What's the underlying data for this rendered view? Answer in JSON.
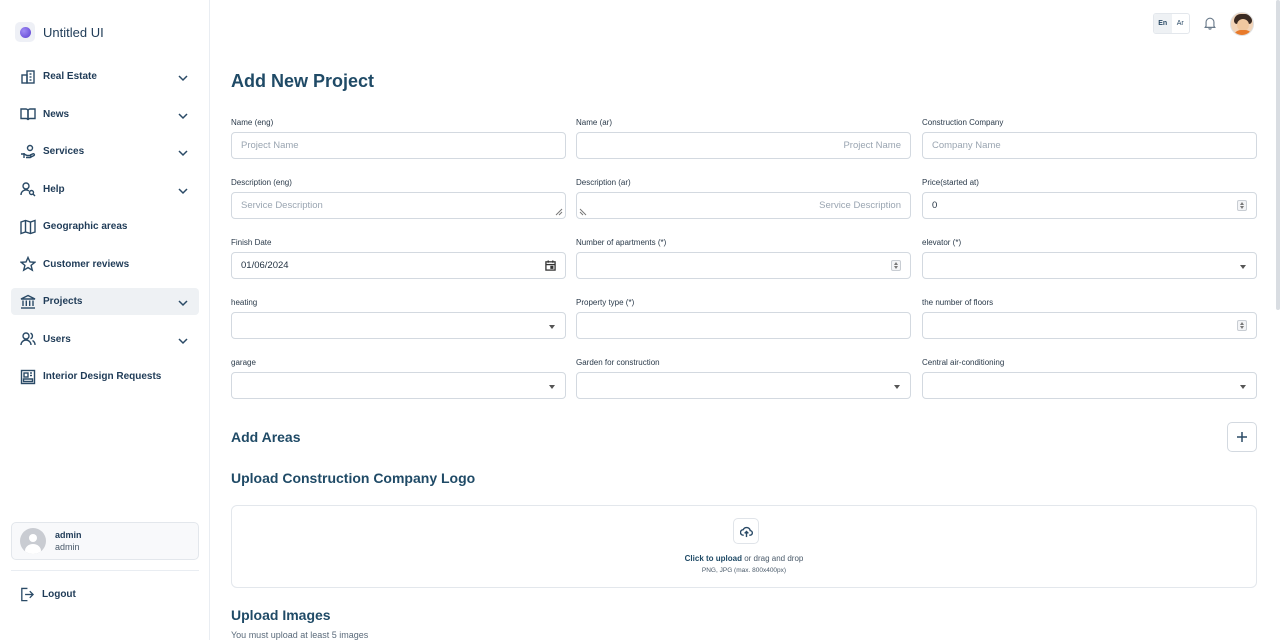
{
  "brand": {
    "name": "Untitled UI"
  },
  "sidebar": {
    "items": [
      {
        "label": "Real Estate"
      },
      {
        "label": "News"
      },
      {
        "label": "Services"
      },
      {
        "label": "Help"
      },
      {
        "label": "Geographic areas"
      },
      {
        "label": "Customer reviews"
      },
      {
        "label": "Projects"
      },
      {
        "label": "Users"
      },
      {
        "label": "Interior Design Requests"
      }
    ],
    "active": "Projects",
    "user": {
      "name": "admin",
      "role": "admin"
    },
    "logout": "Logout"
  },
  "topbar": {
    "lang_en": "En",
    "lang_ar": "Ar"
  },
  "page": {
    "title": "Add New Project"
  },
  "form": {
    "name_eng": {
      "label": "Name (eng)",
      "placeholder": "Project Name"
    },
    "name_ar": {
      "label": "Name (ar)",
      "placeholder": "Project Name"
    },
    "company": {
      "label": "Construction Company",
      "placeholder": "Company Name"
    },
    "desc_eng": {
      "label": "Description (eng)",
      "placeholder": "Service Description"
    },
    "desc_ar": {
      "label": "Description (ar)",
      "placeholder": "Service Description"
    },
    "price": {
      "label": "Price(started at)",
      "value": "0"
    },
    "finish_date": {
      "label": "Finish Date",
      "value": "01/06/2024"
    },
    "apartments": {
      "label": "Number of apartments (*)",
      "value": ""
    },
    "elevator": {
      "label": "elevator (*)",
      "value": ""
    },
    "heating": {
      "label": "heating",
      "value": ""
    },
    "property_type": {
      "label": "Property type (*)",
      "value": ""
    },
    "floors": {
      "label": "the number of floors",
      "value": ""
    },
    "garage": {
      "label": "garage",
      "value": ""
    },
    "garden": {
      "label": "Garden for construction",
      "value": ""
    },
    "central_ac": {
      "label": "Central air-conditioning",
      "value": ""
    }
  },
  "sections": {
    "areas": "Add Areas",
    "logo": "Upload Construction Company Logo",
    "images": "Upload Images",
    "images_note": "You must upload at least 5 images"
  },
  "upload": {
    "click": "Click to upload",
    "drag": " or drag and drop",
    "hint": "PNG, JPG (max. 800x400px)"
  },
  "colors": {
    "accent": "#1f4a66",
    "border": "#d3d9e0",
    "active_bg": "#eef1f4"
  }
}
